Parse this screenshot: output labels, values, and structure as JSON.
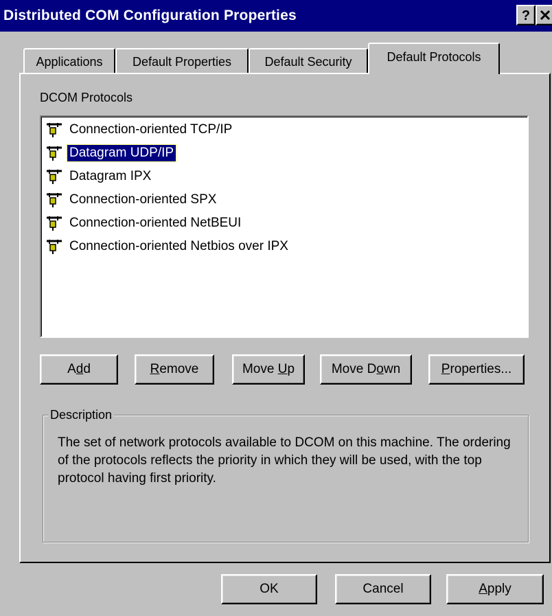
{
  "window": {
    "title": "Distributed COM Configuration Properties",
    "help_label": "?",
    "close_label": "✕"
  },
  "tabs": [
    {
      "label": "Applications",
      "active": false
    },
    {
      "label": "Default Properties",
      "active": false
    },
    {
      "label": "Default Security",
      "active": false
    },
    {
      "label": "Default Protocols",
      "active": true
    }
  ],
  "protocols_section": {
    "label": "DCOM Protocols",
    "items": [
      {
        "label": "Connection-oriented TCP/IP",
        "icon": "plug-icon",
        "selected": false
      },
      {
        "label": "Datagram UDP/IP",
        "icon": "plug-icon",
        "selected": true
      },
      {
        "label": "Datagram IPX",
        "icon": "plug-icon",
        "selected": false
      },
      {
        "label": "Connection-oriented SPX",
        "icon": "plug-icon",
        "selected": false
      },
      {
        "label": "Connection-oriented NetBEUI",
        "icon": "plug-icon",
        "selected": false
      },
      {
        "label": "Connection-oriented Netbios over IPX",
        "icon": "plug-icon",
        "selected": false
      }
    ]
  },
  "list_buttons": {
    "add": {
      "pre": "A",
      "key": "d",
      "post": "d"
    },
    "remove": {
      "pre": "",
      "key": "R",
      "post": "emove"
    },
    "move_up": {
      "pre": "Move ",
      "key": "U",
      "post": "p"
    },
    "move_down": {
      "pre": "Move D",
      "key": "o",
      "post": "wn"
    },
    "properties": {
      "pre": "",
      "key": "P",
      "post": "roperties..."
    }
  },
  "description": {
    "legend": "Description",
    "text": "The set of network protocols available to DCOM on this machine. The ordering of the protocols reflects the priority in which they will be used, with the top protocol having first priority."
  },
  "dialog_buttons": {
    "ok": "OK",
    "cancel": "Cancel",
    "apply": {
      "pre": "",
      "key": "A",
      "post": "pply"
    }
  },
  "colors": {
    "titlebar": "#000080",
    "face": "#c0c0c0",
    "selection": "#000080"
  }
}
